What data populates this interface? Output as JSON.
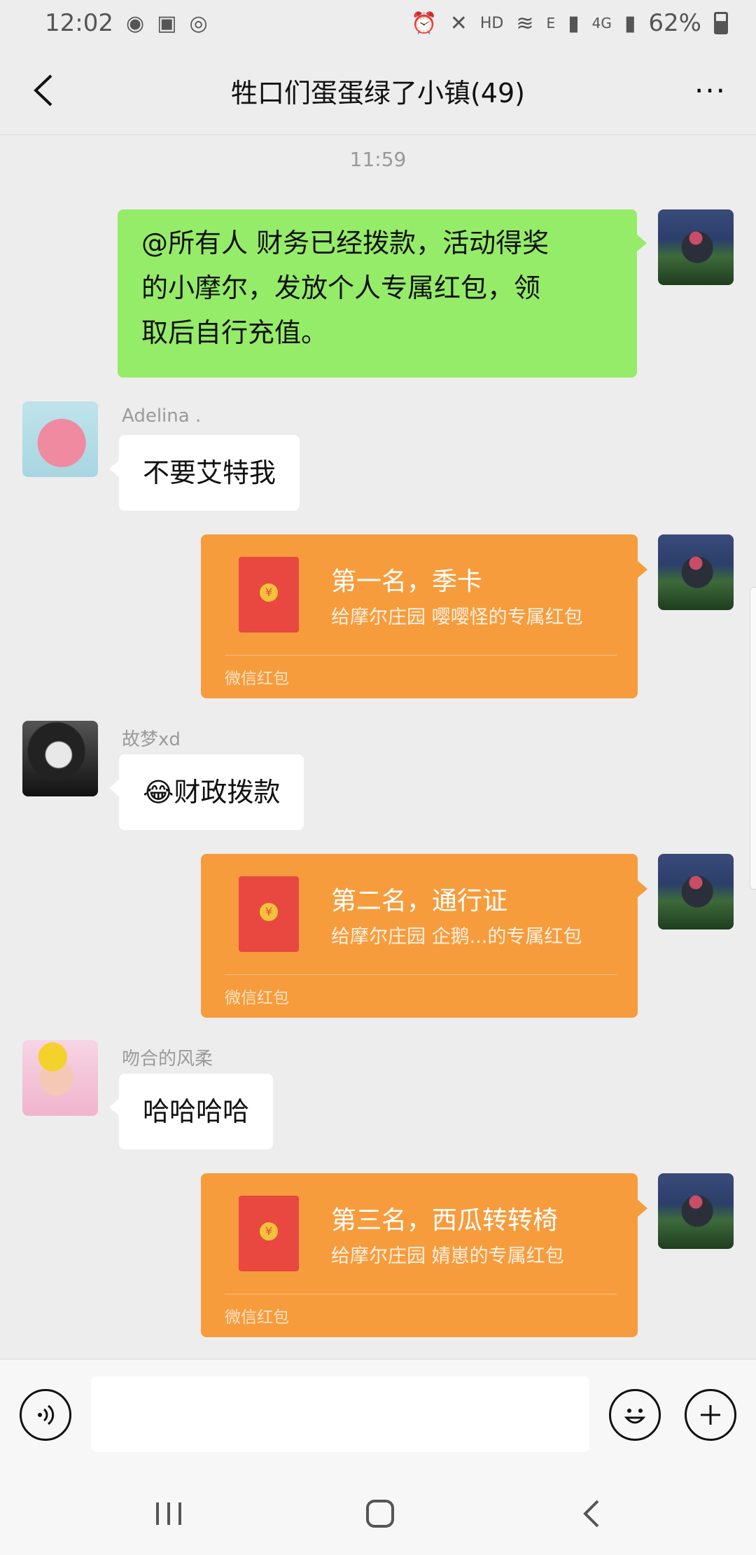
{
  "status_bar": {
    "time": "12:02",
    "network": "HD",
    "signal_labels": [
      "E",
      "4G"
    ],
    "battery": "62%",
    "battery_level": 0.62
  },
  "header": {
    "title": "牲口们蛋蛋绿了小镇(49)",
    "back_icon": "chevron-left-icon",
    "more_icon": "more-dots-icon",
    "more_label": "···"
  },
  "chat": {
    "timestamp": "11:59",
    "messages": [
      {
        "type": "text",
        "side": "right",
        "lines": [
          "@所有人  财务已经拨款，活动得奖",
          "的小摩尔，发放个人专属红包，领",
          "取后自行充值。"
        ]
      },
      {
        "type": "text",
        "side": "left",
        "sender": "Adelina .",
        "text": "不要艾特我"
      },
      {
        "type": "red_packet",
        "side": "right",
        "title": "第一名，季卡",
        "subtitle": "给摩尔庄园 嘤嘤怪的专属红包",
        "footer": "微信红包",
        "coin": "¥"
      },
      {
        "type": "text",
        "side": "left",
        "sender": "故梦xd",
        "text": "😂财政拨款"
      },
      {
        "type": "red_packet",
        "side": "right",
        "title": "第二名，通行证",
        "subtitle": "给摩尔庄园 企鹅...的专属红包",
        "footer": "微信红包",
        "coin": "¥"
      },
      {
        "type": "text",
        "side": "left",
        "sender": "吻合的风柔",
        "text": "哈哈哈哈"
      },
      {
        "type": "red_packet",
        "side": "right",
        "title": "第三名，西瓜转转椅",
        "subtitle": "给摩尔庄园 婧崽的专属红包",
        "footer": "微信红包",
        "coin": "¥"
      }
    ]
  },
  "input_bar": {
    "voice_icon": "voice-icon",
    "emoji_icon": "emoji-icon",
    "plus_icon": "plus-icon",
    "input_value": ""
  },
  "nav_bar": {
    "recent_icon": "recent-apps-icon",
    "home_icon": "home-icon",
    "back_icon": "back-icon"
  },
  "colors": {
    "background": "#ededed",
    "my_bubble": "#95ec69",
    "red_packet": "#f79c3c",
    "envelope": "#e8483f"
  }
}
